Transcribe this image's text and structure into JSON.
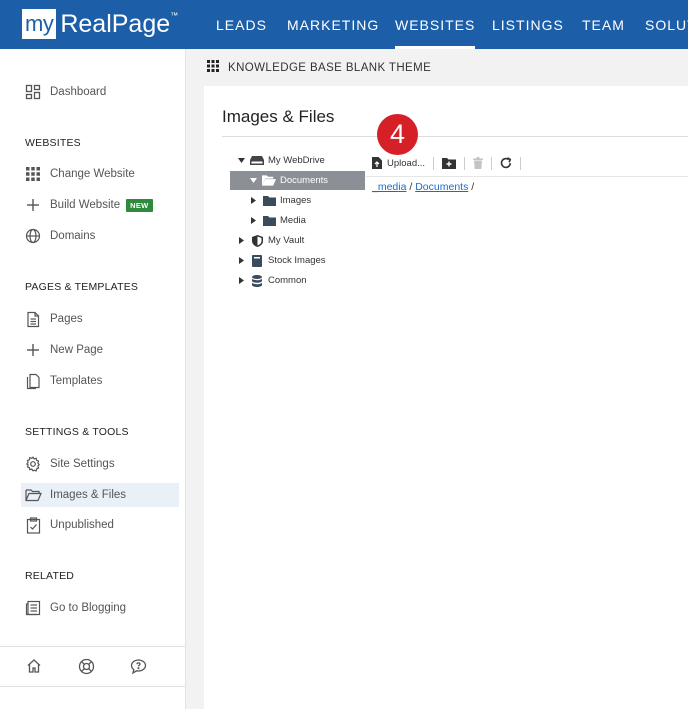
{
  "brand": {
    "my": "my",
    "realpage": "RealPage",
    "tm": "™"
  },
  "topnav": {
    "items": [
      {
        "label": "LEADS",
        "active": false
      },
      {
        "label": "MARKETING",
        "active": false
      },
      {
        "label": "WEBSITES",
        "active": true
      },
      {
        "label": "LISTINGS",
        "active": false
      },
      {
        "label": "TEAM",
        "active": false
      },
      {
        "label": "SOLUT",
        "active": false
      }
    ],
    "bg_color": "#1c5fa8"
  },
  "sidebar": {
    "dashboard": {
      "label": "Dashboard",
      "icon": "dashboard-icon"
    },
    "sections": [
      {
        "heading": "WEBSITES",
        "items": [
          {
            "label": "Change Website",
            "icon": "grid-icon"
          },
          {
            "label": "Build Website",
            "icon": "plus-icon",
            "badge": "NEW"
          },
          {
            "label": "Domains",
            "icon": "globe-icon"
          }
        ]
      },
      {
        "heading": "PAGES & TEMPLATES",
        "items": [
          {
            "label": "Pages",
            "icon": "pages-icon"
          },
          {
            "label": "New Page",
            "icon": "plus-icon"
          },
          {
            "label": "Templates",
            "icon": "templates-icon"
          }
        ]
      },
      {
        "heading": "SETTINGS & TOOLS",
        "items": [
          {
            "label": "Site Settings",
            "icon": "gear-icon"
          },
          {
            "label": "Images & Files",
            "icon": "folder-open-icon",
            "active": true
          },
          {
            "label": "Unpublished",
            "icon": "clipboard-check-icon"
          }
        ]
      },
      {
        "heading": "RELATED",
        "items": [
          {
            "label": "Go to Blogging",
            "icon": "blog-icon"
          }
        ]
      }
    ],
    "footer_icons": [
      "home-icon",
      "help-lifebuoy-icon",
      "chat-question-icon"
    ],
    "badge_color": "#2e8b3e"
  },
  "subheader": {
    "title": "KNOWLEDGE BASE BLANK THEME"
  },
  "main": {
    "title": "Images & Files",
    "step_number": "4",
    "step_color": "#d62027",
    "tree": [
      {
        "label": "My WebDrive",
        "icon": "drive-icon",
        "expanded": true,
        "level": 0
      },
      {
        "label": "Documents",
        "icon": "folder-open-icon",
        "expanded": true,
        "level": 1,
        "selected": true
      },
      {
        "label": "Images",
        "icon": "folder-icon",
        "expanded": false,
        "level": 2
      },
      {
        "label": "Media",
        "icon": "folder-icon",
        "expanded": false,
        "level": 2
      },
      {
        "label": "My Vault",
        "icon": "shield-icon",
        "expanded": false,
        "level": 0
      },
      {
        "label": "Stock Images",
        "icon": "book-icon",
        "expanded": false,
        "level": 0
      },
      {
        "label": "Common",
        "icon": "database-icon",
        "expanded": false,
        "level": 0
      }
    ],
    "toolbar": {
      "upload_label": "Upload...",
      "icons": [
        "file-upload-icon",
        "new-folder-icon",
        "trash-icon",
        "refresh-icon"
      ]
    },
    "path": {
      "segments": [
        "_media",
        "Documents"
      ],
      "separator": "/"
    }
  }
}
